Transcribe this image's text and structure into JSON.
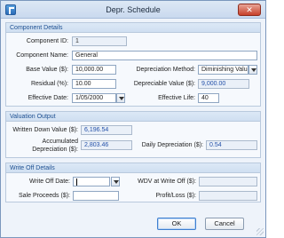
{
  "window": {
    "title": "Depr. Schedule",
    "close_label": "✕"
  },
  "component_details": {
    "title": "Component Details",
    "component_id_label": "Component ID:",
    "component_id": "1",
    "component_name_label": "Component Name:",
    "component_name": "General",
    "base_value_label": "Base Value ($):",
    "base_value": "10,000.00",
    "depreciation_method_label": "Depreciation Method:",
    "depreciation_method": "Diminishing Value",
    "residual_label": "Residual (%):",
    "residual": "10.00",
    "depreciable_value_label": "Depreciable Value ($):",
    "depreciable_value": "9,000.00",
    "effective_date_label": "Effective Date:",
    "effective_date": "1/05/2000",
    "effective_life_label": "Effective Life:",
    "effective_life": "40"
  },
  "valuation_output": {
    "title": "Valuation Output",
    "written_down_label": "Written Down Value ($):",
    "written_down": "6,196.54",
    "accumulated_label_1": "Accumulated",
    "accumulated_label_2": "Depreciation ($):",
    "accumulated": "2,803.46",
    "daily_label": "Daily Depreciation ($):",
    "daily": "0.54"
  },
  "write_off": {
    "title": "Write Off Details",
    "write_off_date_label": "Write Off Date:",
    "write_off_date": "",
    "wdv_label": "WDV at Write Off ($):",
    "wdv": "",
    "sale_proceeds_label": "Sale Proceeds ($):",
    "sale_proceeds": "",
    "profit_loss_label": "Profit/Loss ($):",
    "profit_loss": ""
  },
  "buttons": {
    "ok": "OK",
    "cancel": "Cancel"
  },
  "colors": {
    "accent": "#1d4f91",
    "readonly_text": "#2350a8",
    "close": "#c7402a"
  }
}
